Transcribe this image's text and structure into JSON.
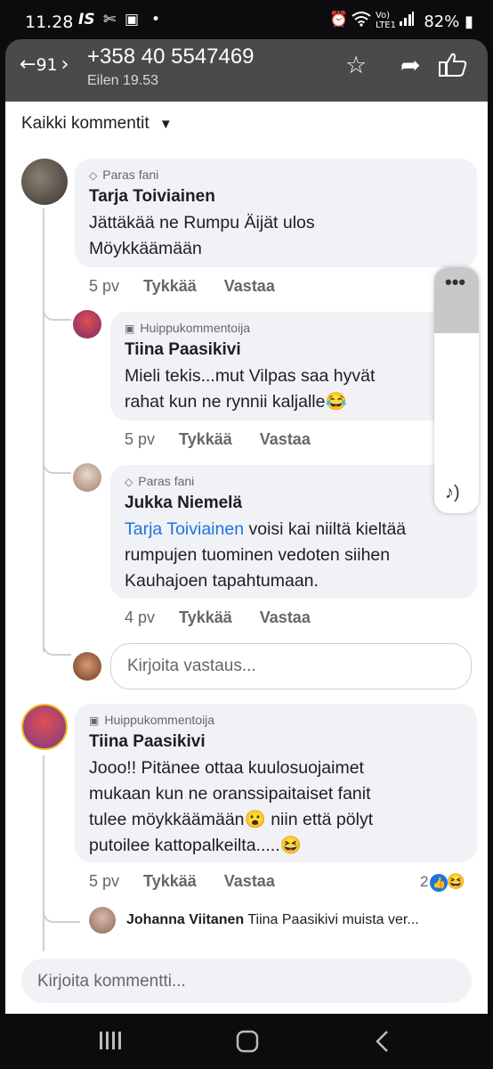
{
  "status_bar": {
    "time": "11.28",
    "left_icons": [
      "IS",
      "✄",
      "▣",
      "•"
    ],
    "network_text": "Vo) LTE1",
    "battery_percent": "82%"
  },
  "header": {
    "back_count": "91",
    "title": "+358 40 5547469",
    "subtitle": "Eilen 19.53"
  },
  "sort_label": "Kaikki kommentit",
  "comments": [
    {
      "badge": "Paras fani",
      "author": "Tarja Toiviainen",
      "text": "Jättäkää ne Rumpu Äijät ulos\nMöykkäämään",
      "time": "5 pv",
      "like": "Tykkää",
      "reply": "Vastaa"
    },
    {
      "badge": "Huippukommentoija",
      "author": "Tiina Paasikivi",
      "text": "Mieli tekis...mut Vilpas saa hyvät\nrahat kun ne rynnii kaljalle😂",
      "time": "5 pv",
      "like": "Tykkää",
      "reply": "Vastaa"
    },
    {
      "badge": "Paras fani",
      "author": "Jukka Niemelä",
      "mention": "Tarja Toiviainen",
      "text": " voisi kai niiltä kieltää\nrumpujen tuominen vedoten siihen\nKauhajoen tapahtumaan.",
      "time": "4 pv",
      "like": "Tykkää",
      "reply": "Vastaa"
    },
    {
      "badge": "Huippukommentoija",
      "author": "Tiina Paasikivi",
      "text": "Jooo!! Pitänee ottaa kuulosuojaimet\nmukaan kun ne oranssipaitaiset fanit\ntulee möykkäämään😮 niin että pölyt\nputoilee kattopalkeilta.....😆",
      "time": "5 pv",
      "like": "Tykkää",
      "reply": "Vastaa",
      "reaction_count": "2"
    }
  ],
  "reply_placeholder": "Kirjoita vastaus...",
  "reply_preview": {
    "author": "Johanna Viitanen",
    "snippet": "Tiina Paasikivi muista ver..."
  },
  "comment_placeholder": "Kirjoita kommentti...",
  "colors": {
    "header_bg": "#4a4a4d",
    "bubble_bg": "#f0f2f5",
    "link_blue": "#1b74e4",
    "secondary_text": "#65676b"
  }
}
